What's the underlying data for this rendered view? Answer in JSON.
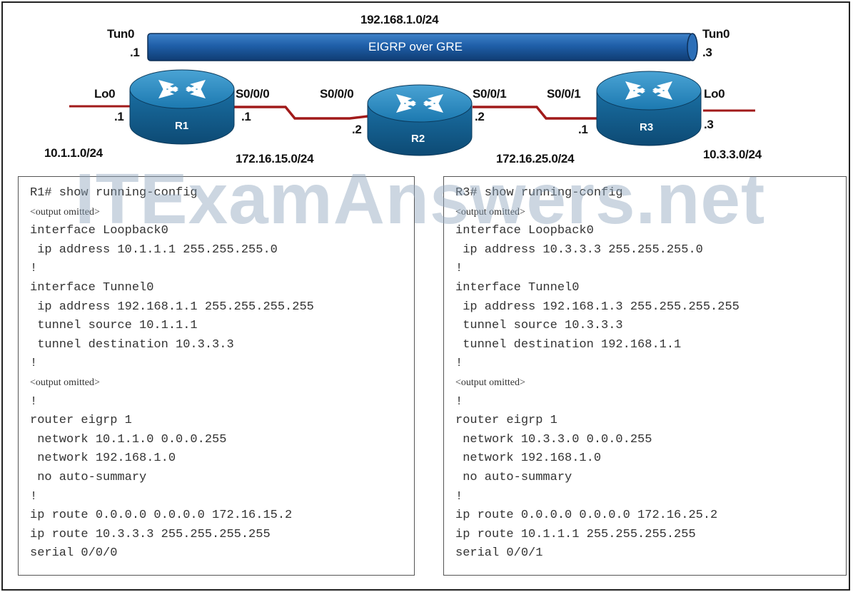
{
  "topology": {
    "tunnel_network": "192.168.1.0/24",
    "tunnel_label": "EIGRP over GRE",
    "r1": {
      "name": "R1",
      "tun_label": "Tun0",
      "tun_ip": ".1",
      "lo_label": "Lo0",
      "lo_ip": ".1",
      "serial_label": "S0/0/0",
      "serial_ip": ".1",
      "lo_network": "10.1.1.0/24"
    },
    "r2": {
      "name": "R2",
      "left_serial_label": "S0/0/0",
      "left_ip": ".2",
      "right_serial_label": "S0/0/1",
      "right_ip": ".2"
    },
    "r3": {
      "name": "R3",
      "tun_label": "Tun0",
      "tun_ip": ".3",
      "lo_label": "Lo0",
      "lo_ip": ".3",
      "serial_label": "S0/0/1",
      "serial_ip": ".1",
      "lo_network": "10.3.3.0/24"
    },
    "link_r1_r2": "172.16.15.0/24",
    "link_r2_r3": "172.16.25.0/24",
    "colors": {
      "tunnel": "#1f5fa8",
      "router": "#1a6fa3",
      "serial_link": "#a11a1a"
    }
  },
  "watermark": "ITExamAnswers.net",
  "r1_config": [
    {
      "text": "R1# show running-config",
      "small": false
    },
    {
      "text": "<output omitted>",
      "small": true
    },
    {
      "text": "interface Loopback0",
      "small": false
    },
    {
      "text": " ip address 10.1.1.1 255.255.255.0",
      "small": false
    },
    {
      "text": "!",
      "small": false
    },
    {
      "text": "interface Tunnel0",
      "small": false
    },
    {
      "text": " ip address 192.168.1.1 255.255.255.255",
      "small": false
    },
    {
      "text": " tunnel source 10.1.1.1",
      "small": false
    },
    {
      "text": " tunnel destination 10.3.3.3",
      "small": false
    },
    {
      "text": "!",
      "small": false
    },
    {
      "text": "<output omitted>",
      "small": true
    },
    {
      "text": "!",
      "small": false
    },
    {
      "text": "router eigrp 1",
      "small": false
    },
    {
      "text": " network 10.1.1.0 0.0.0.255",
      "small": false
    },
    {
      "text": " network 192.168.1.0",
      "small": false
    },
    {
      "text": " no auto-summary",
      "small": false
    },
    {
      "text": "!",
      "small": false
    },
    {
      "text": "ip route 0.0.0.0 0.0.0.0 172.16.15.2",
      "small": false
    },
    {
      "text": "ip route 10.3.3.3 255.255.255.255",
      "small": false
    },
    {
      "text": "serial 0/0/0",
      "small": false
    }
  ],
  "r3_config": [
    {
      "text": "R3# show running-config",
      "small": false
    },
    {
      "text": "<output omitted>",
      "small": true
    },
    {
      "text": "interface Loopback0",
      "small": false
    },
    {
      "text": " ip address 10.3.3.3 255.255.255.0",
      "small": false
    },
    {
      "text": "!",
      "small": false
    },
    {
      "text": "interface Tunnel0",
      "small": false
    },
    {
      "text": " ip address 192.168.1.3 255.255.255.255",
      "small": false
    },
    {
      "text": " tunnel source 10.3.3.3",
      "small": false
    },
    {
      "text": " tunnel destination 192.168.1.1",
      "small": false
    },
    {
      "text": "!",
      "small": false
    },
    {
      "text": "<output omitted>",
      "small": true
    },
    {
      "text": "!",
      "small": false
    },
    {
      "text": "router eigrp 1",
      "small": false
    },
    {
      "text": " network 10.3.3.0 0.0.0.255",
      "small": false
    },
    {
      "text": " network 192.168.1.0",
      "small": false
    },
    {
      "text": " no auto-summary",
      "small": false
    },
    {
      "text": "!",
      "small": false
    },
    {
      "text": "ip route 0.0.0.0 0.0.0.0 172.16.25.2",
      "small": false
    },
    {
      "text": "ip route 10.1.1.1 255.255.255.255",
      "small": false
    },
    {
      "text": "serial 0/0/1",
      "small": false
    }
  ]
}
